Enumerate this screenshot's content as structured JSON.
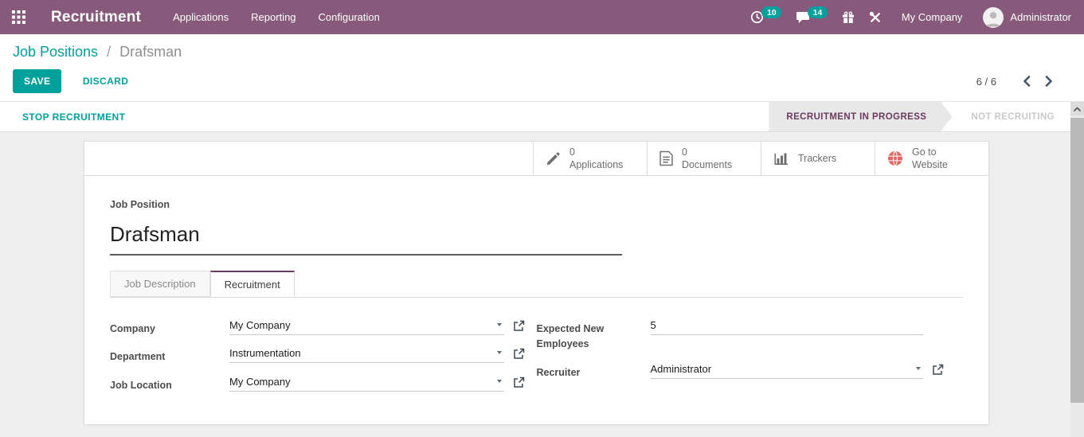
{
  "navbar": {
    "app_name": "Recruitment",
    "menu": [
      {
        "label": "Applications"
      },
      {
        "label": "Reporting"
      },
      {
        "label": "Configuration"
      }
    ],
    "activities_count": "10",
    "messages_count": "14",
    "company_name": "My Company",
    "user_name": "Administrator"
  },
  "breadcrumb": {
    "parent": "Job Positions",
    "separator": "/",
    "current": "Drafsman"
  },
  "actions": {
    "save": "SAVE",
    "discard": "DISCARD"
  },
  "pager": {
    "value": "6 / 6"
  },
  "statusbar": {
    "stop_button": "STOP RECRUITMENT",
    "stages": [
      {
        "label": "RECRUITMENT IN PROGRESS",
        "active": true
      },
      {
        "label": "NOT RECRUITING",
        "active": false
      }
    ]
  },
  "button_box": {
    "applications": {
      "count": "0",
      "label": "Applications"
    },
    "documents": {
      "count": "0",
      "label": "Documents"
    },
    "trackers": {
      "label": "Trackers"
    },
    "website": {
      "label": "Go to Website"
    }
  },
  "form": {
    "job_position_label": "Job Position",
    "job_position_value": "Drafsman",
    "tabs": [
      {
        "label": "Job Description",
        "active": false
      },
      {
        "label": "Recruitment",
        "active": true
      }
    ],
    "company": {
      "label": "Company",
      "value": "My Company"
    },
    "department": {
      "label": "Department",
      "value": "Instrumentation"
    },
    "job_location": {
      "label": "Job Location",
      "value": "My Company"
    },
    "expected_new_employees": {
      "label": "Expected New Employees",
      "value": "5"
    },
    "recruiter": {
      "label": "Recruiter",
      "value": "Administrator"
    }
  },
  "colors": {
    "brand": "#875A7B",
    "accent": "#00A09D",
    "stage_text": "#6B3A5D",
    "website_icon": "#DD6962"
  }
}
